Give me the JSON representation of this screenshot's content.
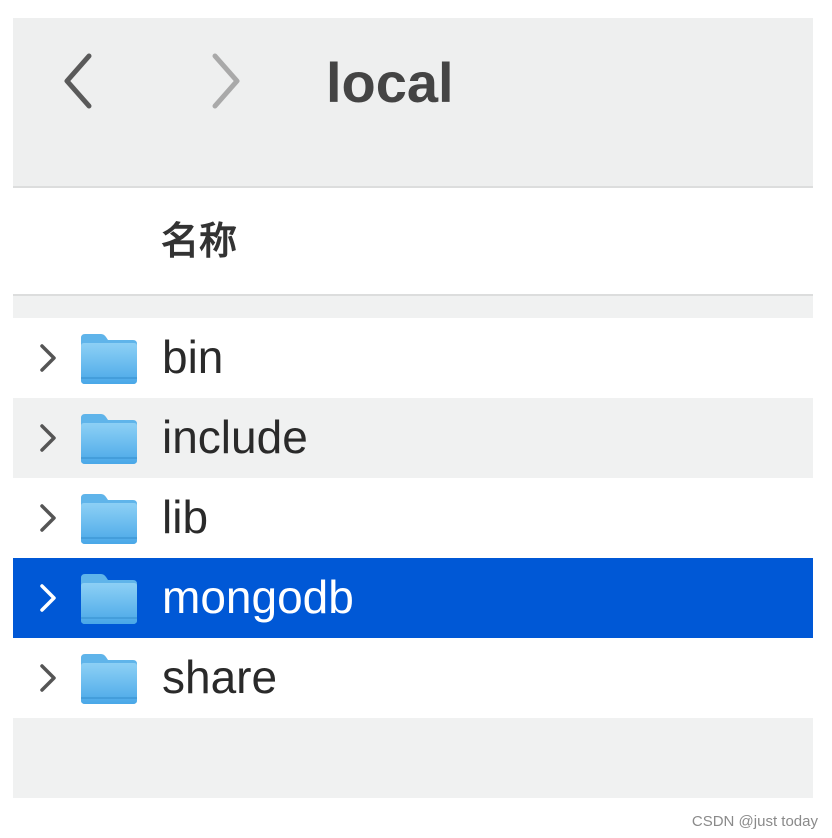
{
  "toolbar": {
    "title": "local",
    "back_icon": "chevron-left-icon",
    "forward_icon": "chevron-right-icon"
  },
  "header": {
    "column_name": "名称"
  },
  "rows": [
    {
      "label": "bin",
      "icon": "folder-icon",
      "selected": false
    },
    {
      "label": "include",
      "icon": "folder-icon",
      "selected": false
    },
    {
      "label": "lib",
      "icon": "folder-icon",
      "selected": false
    },
    {
      "label": "mongodb",
      "icon": "folder-icon",
      "selected": true
    },
    {
      "label": "share",
      "icon": "folder-icon",
      "selected": false
    }
  ],
  "colors": {
    "selection": "#0058d6",
    "folder_top": "#8dd0f5",
    "folder_bottom": "#4aa8e8",
    "toolbar_bg": "#eeefef"
  },
  "watermark": "CSDN @just today"
}
